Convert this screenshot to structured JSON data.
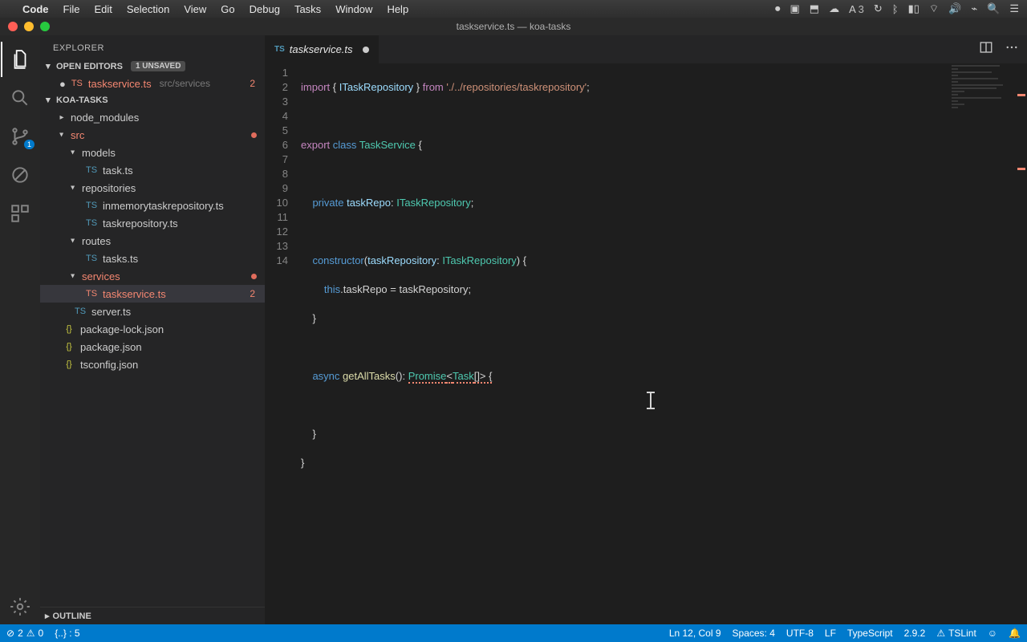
{
  "menubar": {
    "app": "Code",
    "items": [
      "File",
      "Edit",
      "Selection",
      "View",
      "Go",
      "Debug",
      "Tasks",
      "Window",
      "Help"
    ],
    "right_a_label": "3"
  },
  "titlebar": {
    "title": "taskservice.ts — koa-tasks"
  },
  "activitybar": {
    "scm_badge": "1"
  },
  "sidebar": {
    "title": "EXPLORER",
    "open_editors_label": "OPEN EDITORS",
    "unsaved_label": "1 UNSAVED",
    "open_editor_file": "taskservice.ts",
    "open_editor_path": "src/services",
    "open_editor_errors": "2",
    "project": "KOA-TASKS",
    "tree": {
      "node_modules": "node_modules",
      "src": "src",
      "models": "models",
      "task_ts": "task.ts",
      "repositories": "repositories",
      "inmemory": "inmemorytaskrepository.ts",
      "taskrepo": "taskrepository.ts",
      "routes": "routes",
      "tasks_ts": "tasks.ts",
      "services": "services",
      "taskservice": "taskservice.ts",
      "taskservice_errors": "2",
      "server": "server.ts",
      "pkglock": "package-lock.json",
      "pkg": "package.json",
      "tsconfig": "tsconfig.json"
    },
    "outline_label": "OUTLINE"
  },
  "tab": {
    "prefix": "TS",
    "name": "taskservice.ts"
  },
  "code": {
    "lines": [
      "1",
      "2",
      "3",
      "4",
      "5",
      "6",
      "7",
      "8",
      "9",
      "10",
      "11",
      "12",
      "13",
      "14"
    ],
    "l1_import": "import",
    "l1_brace_open": " { ",
    "l1_itask": "ITaskRepository",
    "l1_brace_close": " } ",
    "l1_from": "from",
    "l1_path": " './../repositories/taskrepository'",
    "l1_semi": ";",
    "l3_export": "export",
    "l3_class": " class ",
    "l3_name": "TaskService",
    "l3_open": " {",
    "l5_private": "    private",
    "l5_var": " taskRepo",
    "l5_colon": ": ",
    "l5_type": "ITaskRepository",
    "l5_semi": ";",
    "l7_ctor": "    constructor",
    "l7_paren_open": "(",
    "l7_param": "taskRepository",
    "l7_colon": ": ",
    "l7_type": "ITaskRepository",
    "l7_paren_close": ") {",
    "l8_this": "        this",
    "l8_rest": ".taskRepo = taskRepository;",
    "l9_close": "    }",
    "l11_async": "    async",
    "l11_fn": " getAllTasks",
    "l11_parens": "(): ",
    "l11_promise": "Promise",
    "l11_lt": "<",
    "l11_task": "Task",
    "l11_arr": "[]> {",
    "l13_close": "    }",
    "l14_close": "}"
  },
  "statusbar": {
    "errors": "2",
    "warnings": "0",
    "braces": "{..} : 5",
    "ln_col": "Ln 12, Col 9",
    "spaces": "Spaces: 4",
    "encoding": "UTF-8",
    "eol": "LF",
    "lang": "TypeScript",
    "ts_ver": "2.9.2",
    "lint": "TSLint"
  }
}
